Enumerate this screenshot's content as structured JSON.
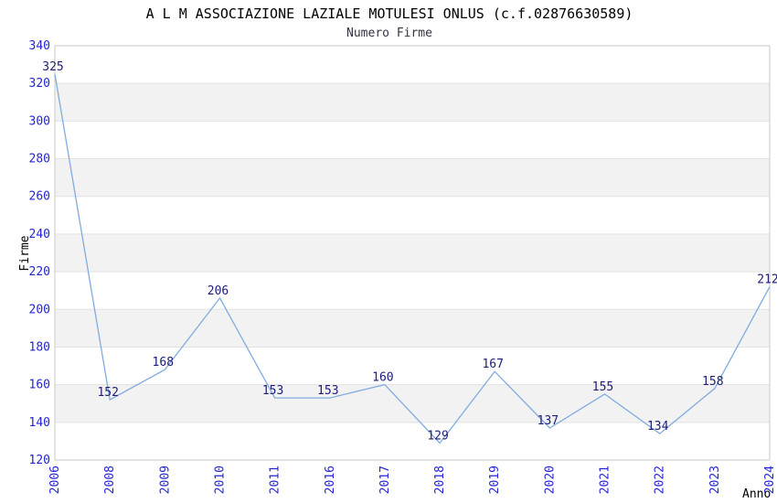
{
  "chart_data": {
    "type": "line",
    "title": "A L M ASSOCIAZIONE LAZIALE MOTULESI ONLUS (c.f.02876630589)",
    "subtitle": "Numero Firme",
    "xlabel": "Anno",
    "ylabel": "Firme",
    "categories": [
      "2006",
      "2008",
      "2009",
      "2010",
      "2011",
      "2016",
      "2017",
      "2018",
      "2019",
      "2020",
      "2021",
      "2022",
      "2023",
      "2024"
    ],
    "values": [
      325,
      152,
      168,
      206,
      153,
      153,
      160,
      129,
      167,
      137,
      155,
      134,
      158,
      212
    ],
    "ylim": [
      120,
      340
    ],
    "ytick_step": 20,
    "yticks": [
      120,
      140,
      160,
      180,
      200,
      220,
      240,
      260,
      280,
      300,
      320,
      340
    ],
    "grid": "horizontal-bands",
    "legend_position": "none",
    "colors": {
      "line": "#80abdf",
      "tick_label": "#2424d6",
      "value_label": "#1c1c78",
      "title": "#000000",
      "subtitle": "#333344",
      "axis_title": "#000000",
      "band_gray": "#f2f2f2",
      "band_white": "#ffffff",
      "gridline": "#e2e2e2",
      "plot_border": "#c9c9c9",
      "background": "#ffffff"
    }
  }
}
